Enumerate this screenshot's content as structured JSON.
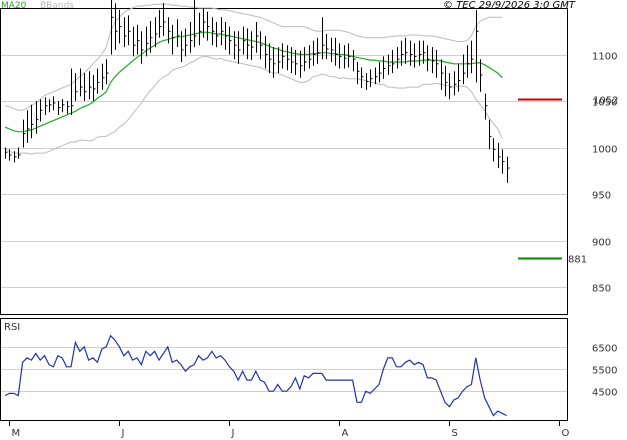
{
  "header": {
    "legend_ma": "MA20",
    "legend_bb": "BBands",
    "copyright": "© TEC 29/9/2026 3:0 GMT"
  },
  "rsi_label": "RSI",
  "colors": {
    "price": "#000000",
    "ma": "#22aa22",
    "bands": "#bbbbbb",
    "rsi": "#2233aa",
    "resistance": "#cc0000",
    "support": "#008800",
    "grid": "#cfcfcf"
  },
  "chart_data": [
    {
      "type": "ohlc",
      "title": "",
      "ylim": [
        820,
        1150
      ],
      "y_ticks": [
        1100,
        1050,
        1000,
        950,
        900,
        850
      ],
      "y_tick_labels": [
        "1100",
        "1050",
        "1000",
        "950",
        "900",
        "850"
      ],
      "x_tick_labels": [
        "M",
        "J",
        "J",
        "A",
        "S",
        "O"
      ],
      "x_tick_index": [
        1,
        26,
        51,
        76,
        101,
        126
      ],
      "close": [
        995,
        992,
        990,
        992,
        1015,
        1020,
        1025,
        1030,
        1040,
        1045,
        1046,
        1048,
        1043,
        1046,
        1044,
        1045,
        1060,
        1065,
        1060,
        1065,
        1063,
        1070,
        1075,
        1080,
        1140,
        1125,
        1130,
        1120,
        1125,
        1110,
        1115,
        1105,
        1112,
        1118,
        1122,
        1130,
        1135,
        1125,
        1118,
        1120,
        1105,
        1110,
        1115,
        1120,
        1125,
        1135,
        1130,
        1125,
        1120,
        1125,
        1120,
        1115,
        1110,
        1105,
        1115,
        1110,
        1108,
        1120,
        1110,
        1100,
        1095,
        1090,
        1092,
        1098,
        1095,
        1092,
        1090,
        1088,
        1092,
        1095,
        1100,
        1102,
        1110,
        1106,
        1105,
        1100,
        1098,
        1096,
        1098,
        1095,
        1082,
        1076,
        1071,
        1074,
        1076,
        1080,
        1085,
        1088,
        1090,
        1095,
        1100,
        1102,
        1100,
        1098,
        1100,
        1102,
        1095,
        1093,
        1090,
        1080,
        1070,
        1065,
        1068,
        1072,
        1080,
        1090,
        1095,
        1125,
        1078,
        1045,
        1012,
        998,
        990,
        985,
        978
      ],
      "high": [
        1000,
        998,
        996,
        1000,
        1030,
        1040,
        1046,
        1050,
        1052,
        1054,
        1052,
        1055,
        1050,
        1052,
        1050,
        1085,
        1080,
        1085,
        1080,
        1082,
        1078,
        1085,
        1090,
        1095,
        1162,
        1155,
        1148,
        1140,
        1142,
        1130,
        1132,
        1125,
        1130,
        1136,
        1140,
        1148,
        1155,
        1140,
        1132,
        1138,
        1125,
        1128,
        1135,
        1160,
        1145,
        1150,
        1146,
        1140,
        1135,
        1140,
        1135,
        1130,
        1125,
        1125,
        1130,
        1128,
        1125,
        1135,
        1125,
        1120,
        1112,
        1108,
        1108,
        1112,
        1110,
        1108,
        1105,
        1104,
        1108,
        1110,
        1115,
        1118,
        1140,
        1122,
        1118,
        1118,
        1112,
        1110,
        1112,
        1105,
        1092,
        1086,
        1080,
        1084,
        1086,
        1092,
        1098,
        1100,
        1105,
        1108,
        1115,
        1118,
        1115,
        1112,
        1115,
        1115,
        1110,
        1108,
        1105,
        1095,
        1088,
        1080,
        1082,
        1090,
        1100,
        1110,
        1115,
        1148,
        1095,
        1058,
        1030,
        1010,
        1005,
        998,
        990
      ],
      "low": [
        988,
        986,
        984,
        988,
        1000,
        1005,
        1010,
        1015,
        1028,
        1035,
        1038,
        1040,
        1035,
        1038,
        1036,
        1035,
        1050,
        1055,
        1050,
        1052,
        1050,
        1058,
        1062,
        1068,
        1100,
        1105,
        1112,
        1108,
        1110,
        1098,
        1100,
        1090,
        1098,
        1102,
        1108,
        1118,
        1120,
        1112,
        1100,
        1108,
        1092,
        1098,
        1102,
        1108,
        1110,
        1118,
        1115,
        1110,
        1108,
        1110,
        1105,
        1100,
        1095,
        1090,
        1100,
        1095,
        1094,
        1102,
        1095,
        1085,
        1080,
        1075,
        1080,
        1085,
        1083,
        1080,
        1078,
        1075,
        1082,
        1085,
        1088,
        1090,
        1095,
        1095,
        1092,
        1088,
        1085,
        1085,
        1086,
        1082,
        1068,
        1064,
        1062,
        1065,
        1068,
        1070,
        1074,
        1078,
        1080,
        1085,
        1088,
        1090,
        1088,
        1086,
        1088,
        1090,
        1082,
        1080,
        1075,
        1062,
        1055,
        1052,
        1056,
        1060,
        1068,
        1075,
        1080,
        1070,
        1060,
        1030,
        998,
        985,
        978,
        972,
        962
      ],
      "ma20": [
        1022,
        1020,
        1018,
        1017,
        1017,
        1018,
        1019,
        1021,
        1023,
        1025,
        1027,
        1029,
        1031,
        1033,
        1035,
        1037,
        1039,
        1042,
        1044,
        1046,
        1049,
        1053,
        1056,
        1060,
        1070,
        1076,
        1081,
        1085,
        1089,
        1093,
        1097,
        1100,
        1104,
        1107,
        1110,
        1113,
        1115,
        1116,
        1118,
        1119,
        1119,
        1120,
        1121,
        1122,
        1123,
        1124,
        1124,
        1123,
        1122,
        1122,
        1121,
        1120,
        1119,
        1118,
        1117,
        1116,
        1115,
        1114,
        1113,
        1111,
        1109,
        1107,
        1106,
        1104,
        1103,
        1102,
        1101,
        1100,
        1100,
        1100,
        1101,
        1101,
        1102,
        1102,
        1101,
        1101,
        1100,
        1100,
        1099,
        1098,
        1097,
        1096,
        1095,
        1094,
        1094,
        1093,
        1093,
        1092,
        1092,
        1092,
        1092,
        1092,
        1093,
        1093,
        1093,
        1094,
        1094,
        1094,
        1094,
        1093,
        1092,
        1091,
        1090,
        1090,
        1090,
        1090,
        1090,
        1091,
        1091,
        1089,
        1086,
        1083,
        1080,
        1075
      ],
      "bb_upper": [
        1045,
        1044,
        1042,
        1040,
        1040,
        1042,
        1045,
        1048,
        1052,
        1056,
        1058,
        1060,
        1062,
        1064,
        1066,
        1068,
        1072,
        1076,
        1080,
        1085,
        1090,
        1095,
        1100,
        1108,
        1125,
        1135,
        1140,
        1145,
        1148,
        1150,
        1152,
        1152,
        1153,
        1153,
        1154,
        1154,
        1154,
        1154,
        1153,
        1153,
        1152,
        1152,
        1151,
        1151,
        1150,
        1150,
        1150,
        1150,
        1149,
        1148,
        1148,
        1147,
        1146,
        1145,
        1144,
        1143,
        1142,
        1141,
        1140,
        1138,
        1136,
        1134,
        1132,
        1130,
        1130,
        1130,
        1130,
        1130,
        1130,
        1128,
        1126,
        1125,
        1125,
        1126,
        1126,
        1126,
        1126,
        1125,
        1124,
        1122,
        1120,
        1119,
        1118,
        1118,
        1118,
        1118,
        1118,
        1119,
        1119,
        1120,
        1120,
        1120,
        1121,
        1121,
        1121,
        1120,
        1120,
        1120,
        1119,
        1118,
        1117,
        1116,
        1115,
        1114,
        1114,
        1115,
        1120,
        1130,
        1136,
        1138,
        1140,
        1140,
        1140,
        1140
      ],
      "bb_lower": [
        999,
        996,
        994,
        994,
        994,
        994,
        993,
        994,
        994,
        994,
        996,
        998,
        1000,
        1002,
        1004,
        1006,
        1006,
        1008,
        1008,
        1007,
        1008,
        1011,
        1012,
        1012,
        1015,
        1017,
        1022,
        1025,
        1030,
        1036,
        1042,
        1048,
        1055,
        1061,
        1066,
        1072,
        1076,
        1078,
        1083,
        1085,
        1086,
        1088,
        1091,
        1093,
        1096,
        1098,
        1098,
        1096,
        1095,
        1096,
        1094,
        1093,
        1092,
        1091,
        1090,
        1089,
        1088,
        1087,
        1086,
        1084,
        1082,
        1080,
        1080,
        1078,
        1076,
        1074,
        1072,
        1070,
        1070,
        1072,
        1076,
        1077,
        1079,
        1078,
        1076,
        1076,
        1074,
        1075,
        1074,
        1074,
        1074,
        1073,
        1072,
        1070,
        1070,
        1068,
        1068,
        1065,
        1065,
        1064,
        1064,
        1064,
        1065,
        1065,
        1065,
        1068,
        1068,
        1068,
        1069,
        1068,
        1067,
        1066,
        1065,
        1066,
        1066,
        1065,
        1060,
        1052,
        1046,
        1040,
        1032,
        1026,
        1020,
        1010
      ],
      "resistance": {
        "value": 1052,
        "label": "1052"
      },
      "support": {
        "value": 881,
        "label": "881"
      }
    },
    {
      "type": "line",
      "title": "RSI",
      "ylim": [
        32,
        78
      ],
      "y_ticks": [
        65,
        55,
        45
      ],
      "y_tick_labels": [
        "6500",
        "5500",
        "4500"
      ],
      "values": [
        43,
        44,
        44,
        43,
        58,
        60,
        59,
        62,
        59,
        61,
        57,
        56,
        61,
        60,
        56,
        56,
        67,
        63,
        65,
        59,
        60,
        58,
        64,
        65,
        70,
        68,
        65,
        61,
        63,
        59,
        60,
        57,
        63,
        61,
        63,
        59,
        62,
        65,
        58,
        59,
        57,
        54,
        56,
        57,
        61,
        59,
        60,
        63,
        60,
        61,
        59,
        56,
        54,
        50,
        54,
        50,
        50,
        54,
        50,
        49,
        45,
        45,
        48,
        45,
        45,
        47,
        51,
        46,
        52,
        51,
        53,
        53,
        53,
        50,
        50,
        50,
        50,
        50,
        50,
        50,
        40,
        40,
        45,
        44,
        46,
        48,
        55,
        60,
        60,
        56,
        56,
        58,
        59,
        57,
        58,
        57,
        51,
        51,
        50,
        45,
        40,
        38,
        41,
        42,
        45,
        47,
        48,
        60,
        50,
        42,
        38,
        34,
        36,
        35,
        34
      ]
    }
  ]
}
